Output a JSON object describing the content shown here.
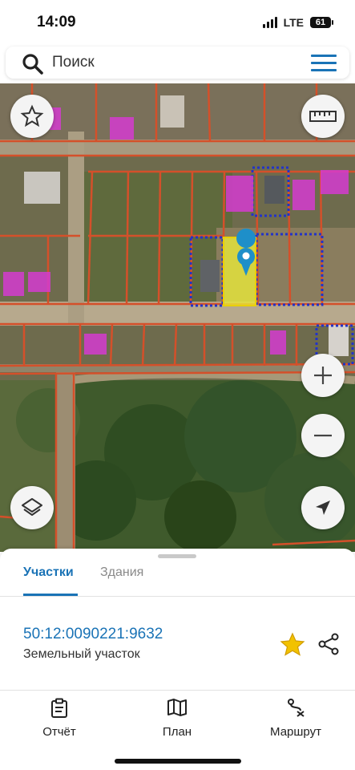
{
  "status_bar": {
    "time": "14:09",
    "network": "LTE",
    "battery": "61"
  },
  "search": {
    "placeholder": "Поиск",
    "icon": "search-icon",
    "menu_icon": "hamburger-menu-icon"
  },
  "map": {
    "buttons": {
      "favorite_icon": "star-outline-icon",
      "ruler_icon": "ruler-icon",
      "zoom_in_icon": "plus-icon",
      "zoom_out_icon": "minus-icon",
      "layers_icon": "layers-icon",
      "locate_icon": "navigation-arrow-icon"
    },
    "colors": {
      "parcel_border": "#d4502a",
      "building": "#d53bd0",
      "selected_parcel": "#e8e83a",
      "dotted_border": "#2233c8",
      "marker": "#1e8fc9"
    }
  },
  "sheet": {
    "tabs": [
      "Участки",
      "Здания"
    ],
    "active_tab": "Участки",
    "cadastral_number": "50:12:0090221:9632",
    "parcel_type": "Земельный участок",
    "accent_color": "#1a73b6",
    "favorite_color": "#f2c200"
  },
  "bottom_nav": [
    {
      "label": "Отчёт",
      "icon": "report-clipboard-icon"
    },
    {
      "label": "План",
      "icon": "map-plan-icon"
    },
    {
      "label": "Маршрут",
      "icon": "route-icon"
    }
  ]
}
